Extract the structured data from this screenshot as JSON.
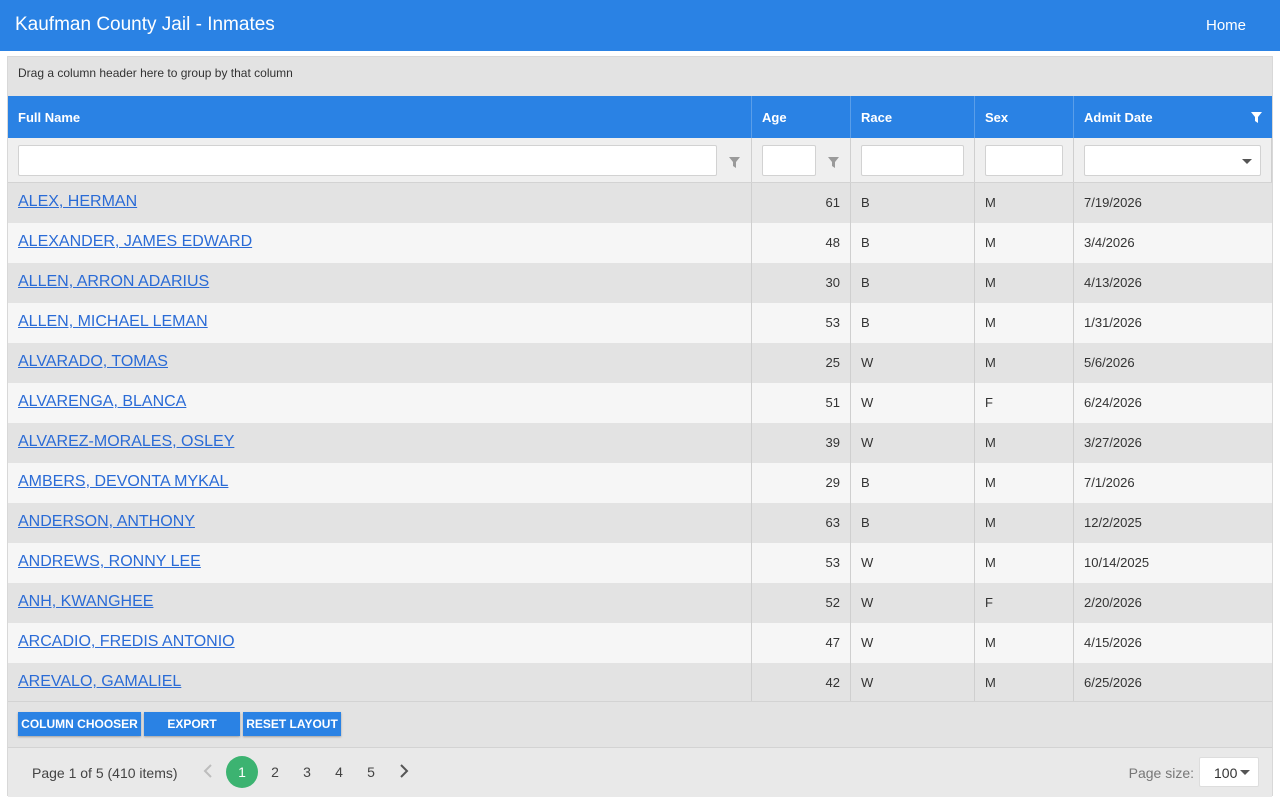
{
  "header": {
    "title": "Kaufman County Jail - Inmates",
    "home_label": "Home"
  },
  "grid": {
    "group_hint": "Drag a column header here to group by that column",
    "columns": [
      "Full Name",
      "Age",
      "Race",
      "Sex",
      "Admit Date"
    ],
    "rows": [
      {
        "name": "ALEX, HERMAN",
        "age": "61",
        "race": "B",
        "sex": "M",
        "admit": "7/19/2026"
      },
      {
        "name": "ALEXANDER, JAMES EDWARD",
        "age": "48",
        "race": "B",
        "sex": "M",
        "admit": "3/4/2026"
      },
      {
        "name": "ALLEN, ARRON ADARIUS",
        "age": "30",
        "race": "B",
        "sex": "M",
        "admit": "4/13/2026"
      },
      {
        "name": "ALLEN, MICHAEL LEMAN",
        "age": "53",
        "race": "B",
        "sex": "M",
        "admit": "1/31/2026"
      },
      {
        "name": "ALVARADO, TOMAS",
        "age": "25",
        "race": "W",
        "sex": "M",
        "admit": "5/6/2026"
      },
      {
        "name": "ALVARENGA, BLANCA",
        "age": "51",
        "race": "W",
        "sex": "F",
        "admit": "6/24/2026"
      },
      {
        "name": "ALVAREZ-MORALES, OSLEY",
        "age": "39",
        "race": "W",
        "sex": "M",
        "admit": "3/27/2026"
      },
      {
        "name": "AMBERS, DEVONTA MYKAL",
        "age": "29",
        "race": "B",
        "sex": "M",
        "admit": "7/1/2026"
      },
      {
        "name": "ANDERSON, ANTHONY",
        "age": "63",
        "race": "B",
        "sex": "M",
        "admit": "12/2/2025"
      },
      {
        "name": "ANDREWS, RONNY LEE",
        "age": "53",
        "race": "W",
        "sex": "M",
        "admit": "10/14/2025"
      },
      {
        "name": "ANH, KWANGHEE",
        "age": "52",
        "race": "W",
        "sex": "F",
        "admit": "2/20/2026"
      },
      {
        "name": "ARCADIO, FREDIS ANTONIO",
        "age": "47",
        "race": "W",
        "sex": "M",
        "admit": "4/15/2026"
      },
      {
        "name": "AREVALO, GAMALIEL",
        "age": "42",
        "race": "W",
        "sex": "M",
        "admit": "6/25/2026"
      }
    ]
  },
  "toolbar": {
    "column_chooser": "COLUMN CHOOSER",
    "export": "EXPORT",
    "reset_layout": "RESET LAYOUT"
  },
  "pager": {
    "info": "Page 1 of 5 (410 items)",
    "pages": [
      "1",
      "2",
      "3",
      "4",
      "5"
    ],
    "page_size_label": "Page size:",
    "page_size": "100"
  },
  "colors": {
    "accent": "#2a82e4",
    "active_page": "#3cb371",
    "link": "#2a6bd6"
  }
}
